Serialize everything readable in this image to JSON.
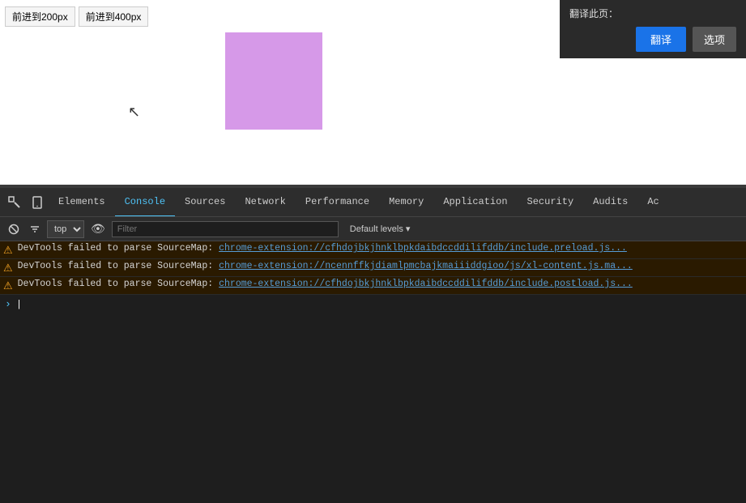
{
  "browser": {
    "btn1_label": "前进到200px",
    "btn2_label": "前进到400px"
  },
  "translation_popup": {
    "title": "翻译此页：",
    "translate_btn": "翻译",
    "options_btn": "选项"
  },
  "devtools": {
    "tabs": [
      {
        "label": "Elements",
        "active": false
      },
      {
        "label": "Console",
        "active": true
      },
      {
        "label": "Sources",
        "active": false
      },
      {
        "label": "Network",
        "active": false
      },
      {
        "label": "Performance",
        "active": false
      },
      {
        "label": "Memory",
        "active": false
      },
      {
        "label": "Application",
        "active": false
      },
      {
        "label": "Security",
        "active": false
      },
      {
        "label": "Audits",
        "active": false
      },
      {
        "label": "Ac",
        "active": false
      }
    ],
    "toolbar": {
      "top_select": "top",
      "filter_placeholder": "Filter",
      "default_levels": "Default levels ▾"
    },
    "console_lines": [
      {
        "type": "warning",
        "text": "DevTools failed to parse SourceMap: ",
        "link": "chrome-extension://cfhdojbkjhnklbpkdaibdccddilifddb/include.preload.js..."
      },
      {
        "type": "warning",
        "text": "DevTools failed to parse SourceMap: ",
        "link": "chrome-extension://ncennffkjdiamlpmcbajkmaiiiddgioo/js/xl-content.js.ma..."
      },
      {
        "type": "warning",
        "text": "DevTools failed to parse SourceMap: ",
        "link": "chrome-extension://cfhdojbkjhnklbpkdaibdccddilifddb/include.postload.js..."
      }
    ]
  }
}
